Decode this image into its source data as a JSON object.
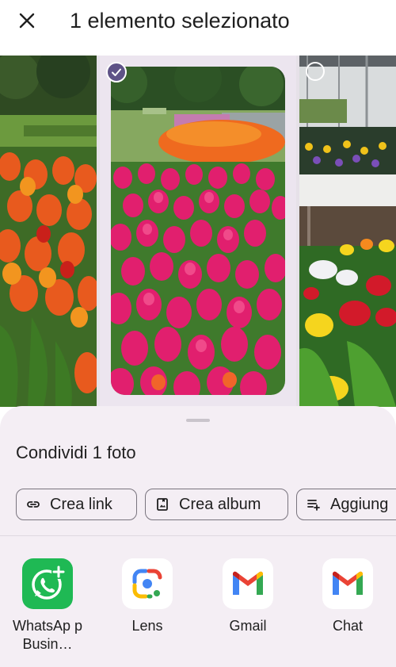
{
  "header": {
    "title": "1 elemento selezionato",
    "close_icon": "close-icon"
  },
  "gallery": {
    "photos": [
      {
        "name": "orange tulips",
        "selected": false
      },
      {
        "name": "pink tulips",
        "selected": true
      },
      {
        "name": "greenhouse pansies",
        "selected": false
      }
    ]
  },
  "share_sheet": {
    "title": "Condividi 1 foto",
    "actions": [
      {
        "label": "Crea link",
        "icon": "link-icon"
      },
      {
        "label": "Crea album",
        "icon": "album-icon"
      },
      {
        "label": "Aggiung",
        "icon": "playlist-add-icon"
      }
    ],
    "apps": [
      {
        "label": "WhatsAp p Busin…",
        "icon": "whatsapp-business-icon"
      },
      {
        "label": "Lens",
        "icon": "google-lens-icon"
      },
      {
        "label": "Gmail",
        "icon": "gmail-icon"
      },
      {
        "label": "Chat",
        "icon": "gmail-chat-icon"
      }
    ]
  },
  "colors": {
    "sheet_background": "#f4eef4",
    "selection_accent": "#5e5287",
    "whatsapp_green": "#1fb954"
  }
}
